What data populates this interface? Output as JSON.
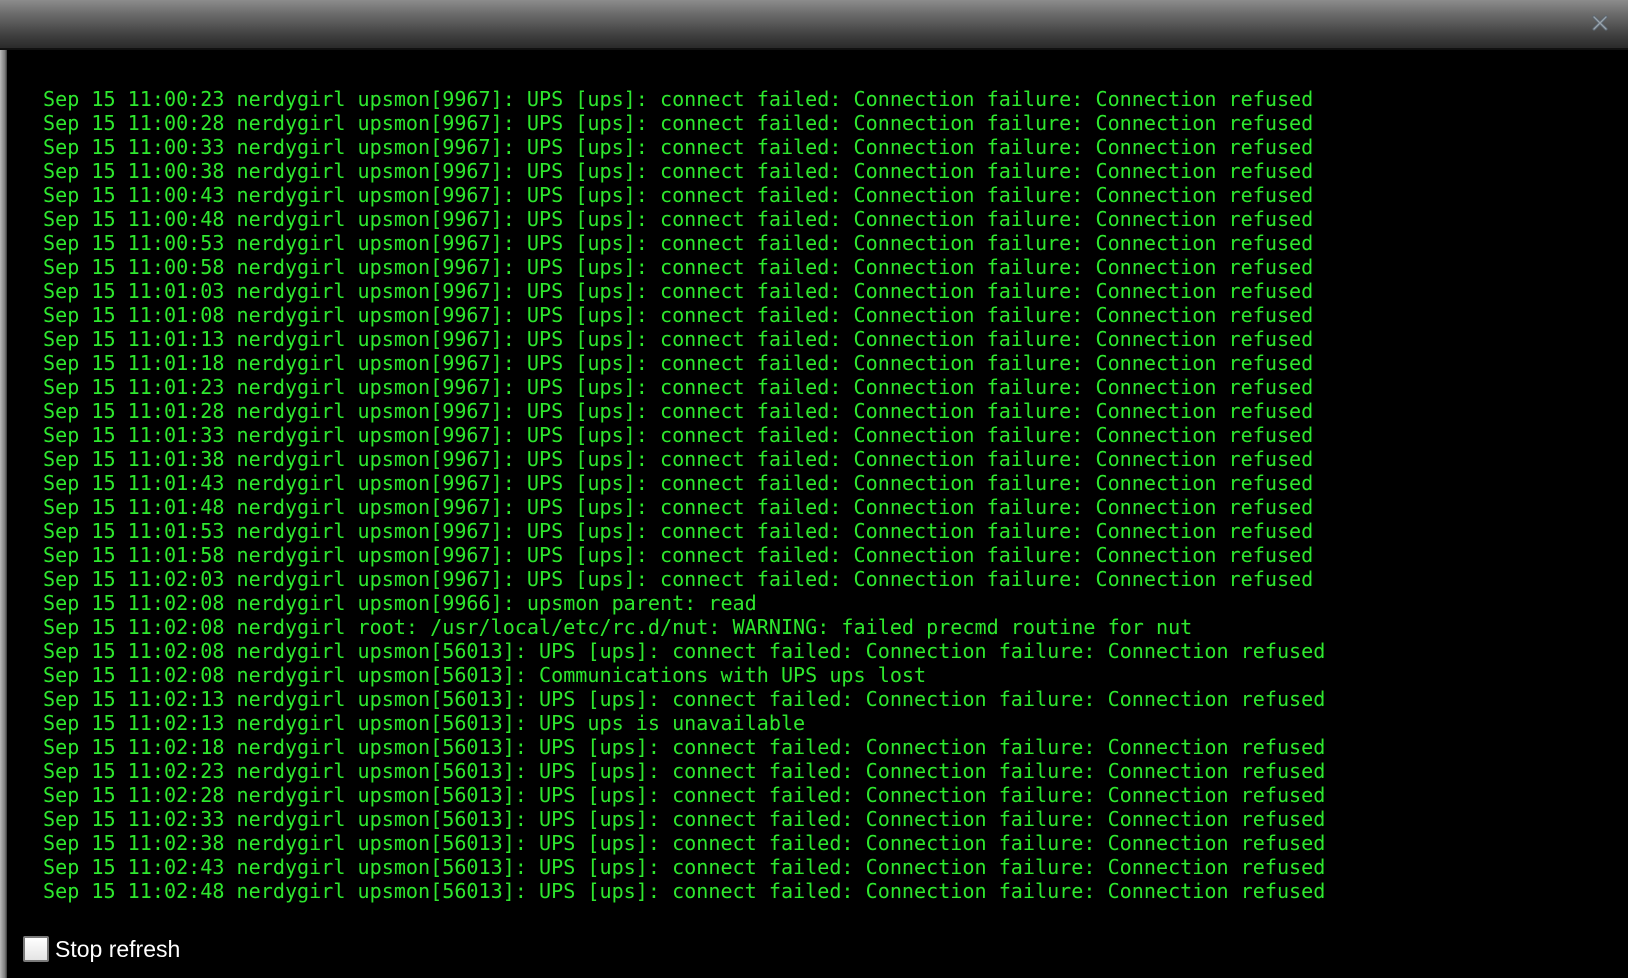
{
  "window": {
    "close_icon": "close-x-icon"
  },
  "log": {
    "lines": [
      "Sep 15 11:00:23 nerdygirl upsmon[9967]: UPS [ups]: connect failed: Connection failure: Connection refused",
      "Sep 15 11:00:28 nerdygirl upsmon[9967]: UPS [ups]: connect failed: Connection failure: Connection refused",
      "Sep 15 11:00:33 nerdygirl upsmon[9967]: UPS [ups]: connect failed: Connection failure: Connection refused",
      "Sep 15 11:00:38 nerdygirl upsmon[9967]: UPS [ups]: connect failed: Connection failure: Connection refused",
      "Sep 15 11:00:43 nerdygirl upsmon[9967]: UPS [ups]: connect failed: Connection failure: Connection refused",
      "Sep 15 11:00:48 nerdygirl upsmon[9967]: UPS [ups]: connect failed: Connection failure: Connection refused",
      "Sep 15 11:00:53 nerdygirl upsmon[9967]: UPS [ups]: connect failed: Connection failure: Connection refused",
      "Sep 15 11:00:58 nerdygirl upsmon[9967]: UPS [ups]: connect failed: Connection failure: Connection refused",
      "Sep 15 11:01:03 nerdygirl upsmon[9967]: UPS [ups]: connect failed: Connection failure: Connection refused",
      "Sep 15 11:01:08 nerdygirl upsmon[9967]: UPS [ups]: connect failed: Connection failure: Connection refused",
      "Sep 15 11:01:13 nerdygirl upsmon[9967]: UPS [ups]: connect failed: Connection failure: Connection refused",
      "Sep 15 11:01:18 nerdygirl upsmon[9967]: UPS [ups]: connect failed: Connection failure: Connection refused",
      "Sep 15 11:01:23 nerdygirl upsmon[9967]: UPS [ups]: connect failed: Connection failure: Connection refused",
      "Sep 15 11:01:28 nerdygirl upsmon[9967]: UPS [ups]: connect failed: Connection failure: Connection refused",
      "Sep 15 11:01:33 nerdygirl upsmon[9967]: UPS [ups]: connect failed: Connection failure: Connection refused",
      "Sep 15 11:01:38 nerdygirl upsmon[9967]: UPS [ups]: connect failed: Connection failure: Connection refused",
      "Sep 15 11:01:43 nerdygirl upsmon[9967]: UPS [ups]: connect failed: Connection failure: Connection refused",
      "Sep 15 11:01:48 nerdygirl upsmon[9967]: UPS [ups]: connect failed: Connection failure: Connection refused",
      "Sep 15 11:01:53 nerdygirl upsmon[9967]: UPS [ups]: connect failed: Connection failure: Connection refused",
      "Sep 15 11:01:58 nerdygirl upsmon[9967]: UPS [ups]: connect failed: Connection failure: Connection refused",
      "Sep 15 11:02:03 nerdygirl upsmon[9967]: UPS [ups]: connect failed: Connection failure: Connection refused",
      "Sep 15 11:02:08 nerdygirl upsmon[9966]: upsmon parent: read",
      "Sep 15 11:02:08 nerdygirl root: /usr/local/etc/rc.d/nut: WARNING: failed precmd routine for nut",
      "Sep 15 11:02:08 nerdygirl upsmon[56013]: UPS [ups]: connect failed: Connection failure: Connection refused",
      "Sep 15 11:02:08 nerdygirl upsmon[56013]: Communications with UPS ups lost",
      "Sep 15 11:02:13 nerdygirl upsmon[56013]: UPS [ups]: connect failed: Connection failure: Connection refused",
      "Sep 15 11:02:13 nerdygirl upsmon[56013]: UPS ups is unavailable",
      "Sep 15 11:02:18 nerdygirl upsmon[56013]: UPS [ups]: connect failed: Connection failure: Connection refused",
      "Sep 15 11:02:23 nerdygirl upsmon[56013]: UPS [ups]: connect failed: Connection failure: Connection refused",
      "Sep 15 11:02:28 nerdygirl upsmon[56013]: UPS [ups]: connect failed: Connection failure: Connection refused",
      "Sep 15 11:02:33 nerdygirl upsmon[56013]: UPS [ups]: connect failed: Connection failure: Connection refused",
      "Sep 15 11:02:38 nerdygirl upsmon[56013]: UPS [ups]: connect failed: Connection failure: Connection refused",
      "Sep 15 11:02:43 nerdygirl upsmon[56013]: UPS [ups]: connect failed: Connection failure: Connection refused",
      "Sep 15 11:02:48 nerdygirl upsmon[56013]: UPS [ups]: connect failed: Connection failure: Connection refused"
    ],
    "text_color": "#2ee82e",
    "background": "#000000"
  },
  "footer": {
    "stop_refresh_label": "Stop refresh",
    "stop_refresh_checked": false
  }
}
